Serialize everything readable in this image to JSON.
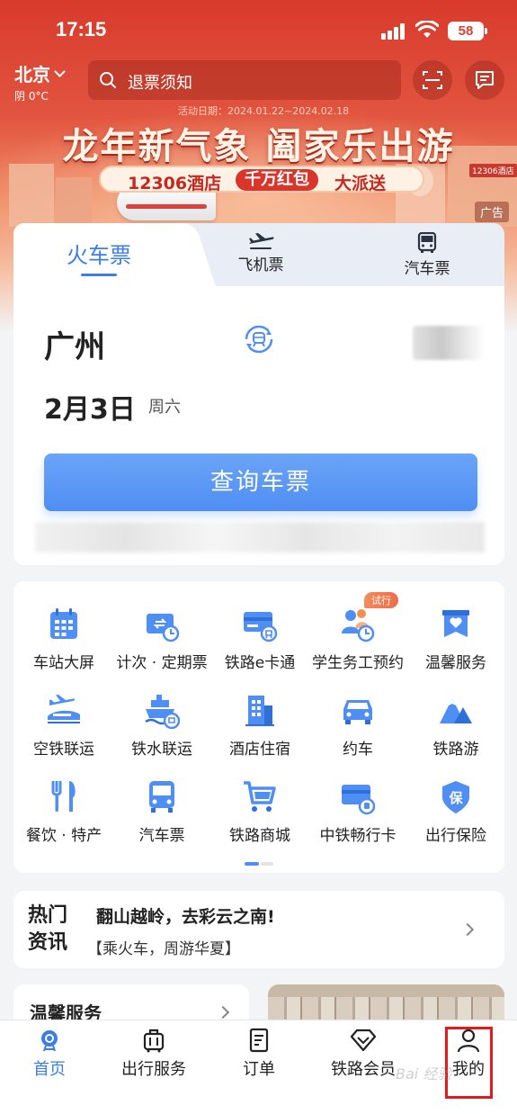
{
  "status_bar": {
    "time": "17:15",
    "battery": "58"
  },
  "top_bar": {
    "city": "北京",
    "weather": "阴 0°C",
    "search_placeholder": "退票须知"
  },
  "banner": {
    "date": "活动日期：2024.01.22~2024.02.18",
    "title": "龙年新气象 阖家乐出游",
    "pill_left": "12306酒店",
    "pill_mid": "千万红包",
    "pill_right": "大派送",
    "hotel_tag": "12306酒店",
    "ad_label": "广告"
  },
  "ticket_tabs": [
    {
      "label": "火车票",
      "icon": "train-icon"
    },
    {
      "label": "飞机票",
      "icon": "airplane-icon"
    },
    {
      "label": "汽车票",
      "icon": "bus-icon"
    }
  ],
  "ticket": {
    "from_city": "广州",
    "date": "2月3日",
    "weekday": "周六",
    "query_button": "查询车票"
  },
  "services": [
    {
      "label": "车站大屏",
      "icon": "station-screen-icon"
    },
    {
      "label": "计次 · 定期票",
      "icon": "period-ticket-icon"
    },
    {
      "label": "铁路e卡通",
      "icon": "e-card-icon"
    },
    {
      "label": "学生务工预约",
      "icon": "student-worker-icon",
      "badge": "试行"
    },
    {
      "label": "温馨服务",
      "icon": "warm-service-icon"
    },
    {
      "label": "空铁联运",
      "icon": "air-rail-icon"
    },
    {
      "label": "铁水联运",
      "icon": "rail-sea-icon"
    },
    {
      "label": "酒店住宿",
      "icon": "hotel-icon"
    },
    {
      "label": "约车",
      "icon": "car-icon"
    },
    {
      "label": "铁路游",
      "icon": "rail-tour-icon"
    },
    {
      "label": "餐饮 · 特产",
      "icon": "dining-icon"
    },
    {
      "label": "汽车票",
      "icon": "bus-ticket-icon"
    },
    {
      "label": "铁路商城",
      "icon": "mall-cart-icon"
    },
    {
      "label": "中铁畅行卡",
      "icon": "rail-card-icon"
    },
    {
      "label": "出行保险",
      "icon": "insurance-icon"
    }
  ],
  "news": {
    "tag_line1": "热门",
    "tag_line2": "资讯",
    "title": "翻山越岭，去彩云之南!",
    "subtitle": "【乘火车，周游华夏】"
  },
  "warm_service": {
    "title": "温馨服务"
  },
  "tabbar": [
    {
      "label": "首页",
      "icon": "home-icon",
      "active": true
    },
    {
      "label": "出行服务",
      "icon": "luggage-icon"
    },
    {
      "label": "订单",
      "icon": "order-icon"
    },
    {
      "label": "铁路会员",
      "icon": "diamond-icon"
    },
    {
      "label": "我的",
      "icon": "profile-icon"
    }
  ],
  "watermark": "Bai 经验",
  "colors": {
    "brand_blue": "#4f8ef3",
    "banner_red": "#d83a2c",
    "highlight_red": "#e3191c"
  }
}
